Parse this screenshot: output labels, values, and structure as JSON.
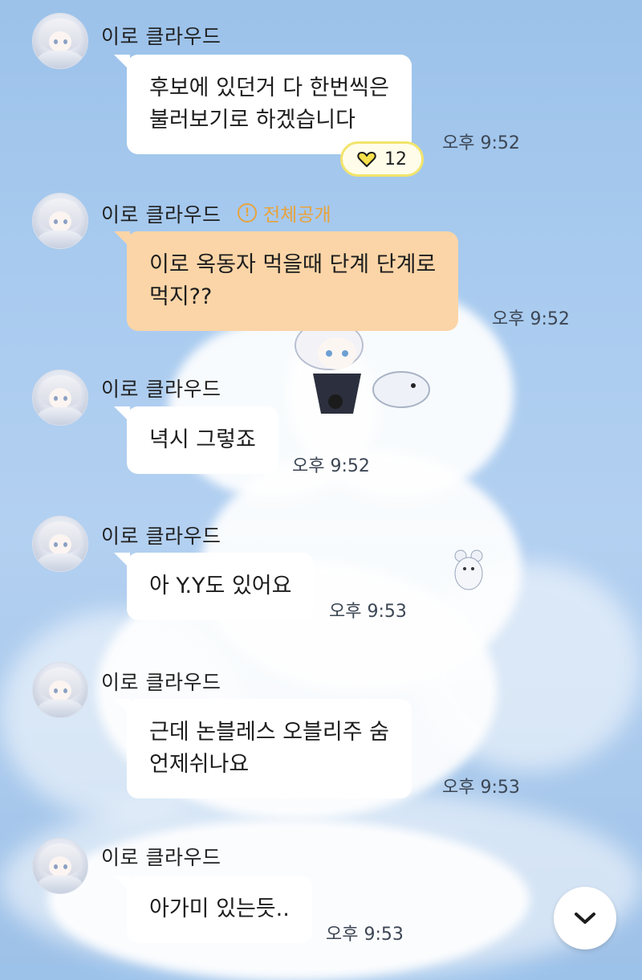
{
  "messages": [
    {
      "sender": "이로 클라우드",
      "lines": [
        "후보에 있던거 다 한번씩은",
        "불러보기로 하겠습니다"
      ],
      "time": "오후 9:52",
      "reaction": {
        "icon": "heart-icon",
        "count": "12"
      }
    },
    {
      "sender": "이로 클라우드",
      "notice_label": "전체공개",
      "lines": [
        "이로 옥동자 먹을때 단계 단계로",
        "먹지??"
      ],
      "time": "오후 9:52"
    },
    {
      "sender": "이로 클라우드",
      "lines": [
        "녁시 그렇죠"
      ],
      "time": "오후 9:52"
    },
    {
      "sender": "이로 클라우드",
      "lines": [
        "아 Y.Y도 있어요"
      ],
      "time": "오후 9:53"
    },
    {
      "sender": "이로 클라우드",
      "lines": [
        "근데 논블레스 오블리주 숨",
        "언제쉬나요"
      ],
      "time": "오후 9:53"
    },
    {
      "sender": "이로 클라우드",
      "lines": [
        "아가미 있는듯.."
      ],
      "time": "오후 9:53"
    }
  ],
  "colors": {
    "notice_bubble": "#fbd5a7",
    "notice_text": "#e8a33c",
    "reaction_border": "#f2e46b",
    "heart": "#f6e04b"
  },
  "scroll_button": {
    "icon": "chevron-down-icon"
  }
}
